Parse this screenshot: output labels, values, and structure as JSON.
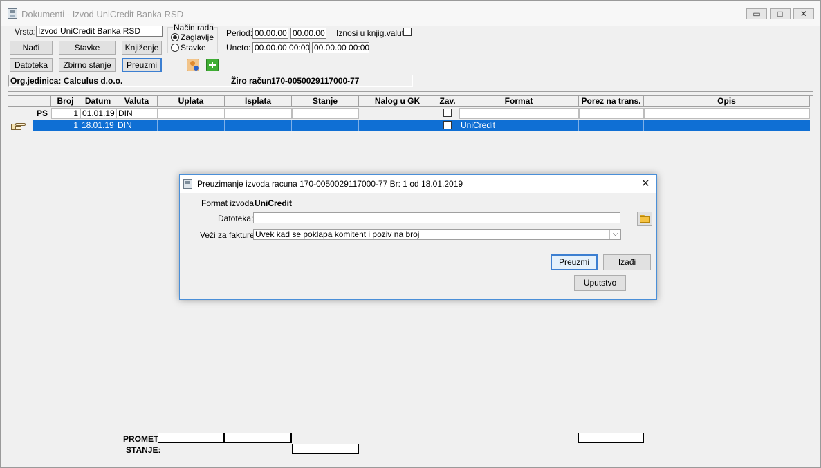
{
  "window": {
    "title": "Dokumenti - Izvod UniCredit Banka RSD",
    "minimize": "▭",
    "maximize": "□",
    "close": "✕"
  },
  "form": {
    "vrsta_label": "Vrsta:",
    "vrsta_value": "Izvod UniCredit Banka RSD",
    "nacin_rada_label": "Način rada",
    "radio_zaglavlje": "Zaglavlje",
    "radio_stavke": "Stavke",
    "period_label": "Period:",
    "period_from": "00.00.00",
    "period_to": "00.00.00",
    "uneto_label": "Uneto:",
    "uneto_from": "00.00.00 00:00",
    "uneto_to": "00.00.00 00:00",
    "iznosi_label": "Iznosi u knjig.valuti:"
  },
  "buttons": {
    "nadji": "Nađi",
    "stavke": "Stavke",
    "knjizenje": "Knjiženje",
    "datoteka": "Datoteka",
    "zbirno": "Zbirno stanje",
    "preuzmi": "Preuzmi"
  },
  "info": {
    "org_label": "Org.jedinica:",
    "org_value": "Calculus d.o.o.",
    "ziro_label": "Žiro račun:",
    "ziro_value": "170-0050029117000-77"
  },
  "grid": {
    "columns": [
      "Broj",
      "Datum",
      "Valuta",
      "Uplata",
      "Isplata",
      "Stanje",
      "Nalog u GK",
      "Zav.",
      "Format",
      "Porez na trans.",
      "Opis"
    ],
    "rows": [
      {
        "marker": "PS",
        "broj": "1",
        "datum": "01.01.19",
        "valuta": "DIN",
        "format": ""
      },
      {
        "marker": "",
        "broj": "1",
        "datum": "18.01.19",
        "valuta": "DIN",
        "format": "UniCredit"
      }
    ]
  },
  "totals": {
    "promet_label": "PROMET:",
    "stanje_label": "STANJE:"
  },
  "dialog": {
    "title": "Preuzimanje izvoda racuna 170-0050029117000-77   Br: 1 od 18.01.2019",
    "close": "✕",
    "format_label": "Format izvoda:",
    "format_value": "UniCredit",
    "datoteka_label": "Datoteka:",
    "datoteka_value": "",
    "vezi_label": "Veži za fakture:",
    "vezi_value": "Uvek kad se poklapa komitent i poziv na broj",
    "btn_preuzmi": "Preuzmi",
    "btn_izadji": "Izađi",
    "btn_uputstvo": "Uputstvo"
  },
  "colors": {
    "selection": "#0f6fd4",
    "focus_border": "#3c7fd1"
  }
}
